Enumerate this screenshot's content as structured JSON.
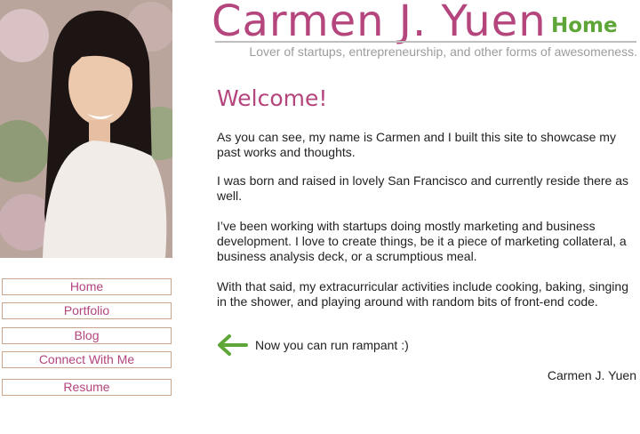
{
  "site": {
    "name": "Carmen J. Yuen",
    "page_label": "Home",
    "tagline": "Lover of startups, entrepreneurship, and other forms of awesomeness."
  },
  "colors": {
    "accent_pink": "#b5457d",
    "accent_green": "#5ea637",
    "nav_border": "#c9a58c",
    "tagline_gray": "#9c9c9c"
  },
  "nav": {
    "items": [
      {
        "label": "Home"
      },
      {
        "label": "Portfolio"
      },
      {
        "label": "Blog"
      },
      {
        "label": "Connect With Me"
      },
      {
        "label": "Resume"
      }
    ]
  },
  "content": {
    "heading": "Welcome!",
    "paragraphs": [
      "As you can see, my name is Carmen and I built this site to showcase my past works and thoughts.",
      "I was born and raised in lovely San Francisco and currently reside there as well.",
      "I’ve been working with startups doing mostly marketing and business development. I love to create things, be it a piece of marketing collateral, a business analysis deck, or a scrumptious meal.",
      "With that said, my extracurricular activities include cooking, baking, singing in the shower, and playing around with random bits of front-end code."
    ],
    "arrow_text": "Now you can run rampant :)",
    "arrow_icon": "arrow-left-icon",
    "signature": "Carmen J. Yuen"
  }
}
